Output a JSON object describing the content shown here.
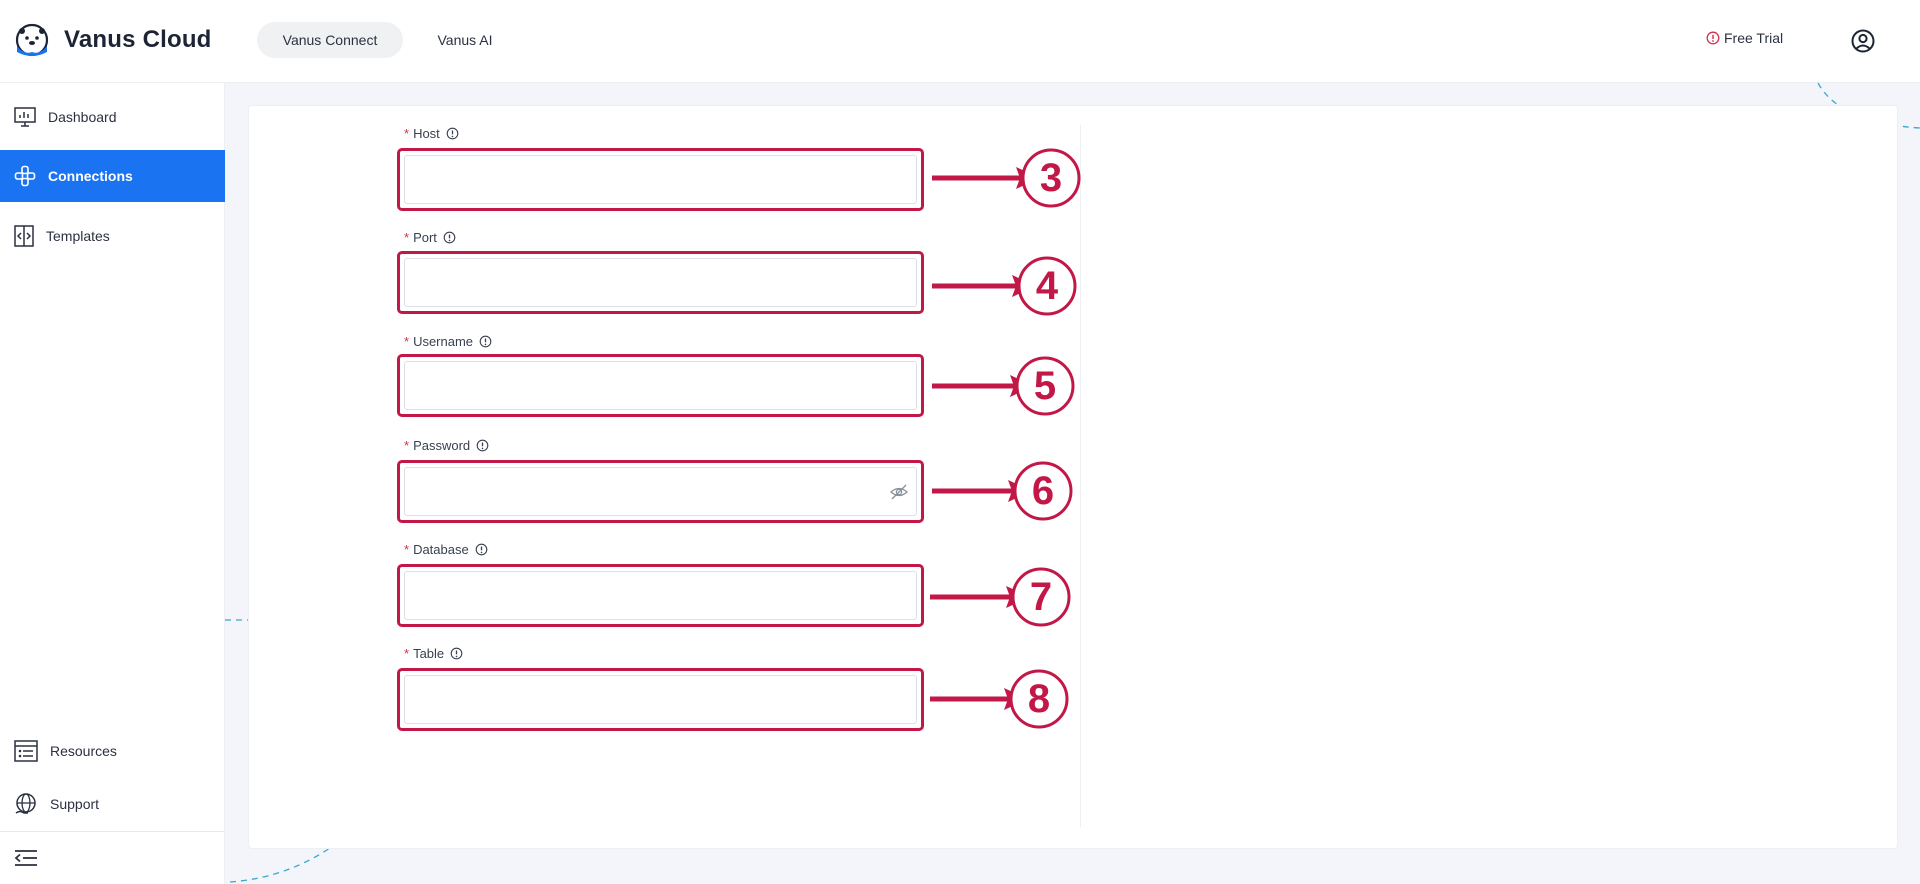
{
  "app": {
    "name": "Vanus Cloud"
  },
  "top_tabs": [
    {
      "label": "Vanus Connect",
      "active": true
    },
    {
      "label": "Vanus AI",
      "active": false
    }
  ],
  "header": {
    "free_trial_label": "Free Trial"
  },
  "sidebar": {
    "items": [
      {
        "label": "Dashboard",
        "icon": "dashboard-icon",
        "active": false
      },
      {
        "label": "Connections",
        "icon": "connections-icon",
        "active": true
      },
      {
        "label": "Templates",
        "icon": "templates-icon",
        "active": false
      }
    ],
    "bottom_items": [
      {
        "label": "Resources",
        "icon": "resources-icon"
      },
      {
        "label": "Support",
        "icon": "support-icon"
      }
    ]
  },
  "form": {
    "fields": [
      {
        "label": "Host",
        "required": true,
        "value": "",
        "callout": "3"
      },
      {
        "label": "Port",
        "required": true,
        "value": "",
        "callout": "4"
      },
      {
        "label": "Username",
        "required": true,
        "value": "",
        "callout": "5"
      },
      {
        "label": "Password",
        "required": true,
        "value": "",
        "callout": "6",
        "masked": true
      },
      {
        "label": "Database",
        "required": true,
        "value": "",
        "callout": "7"
      },
      {
        "label": "Table",
        "required": true,
        "value": "",
        "callout": "8"
      }
    ]
  },
  "colors": {
    "accent": "#1a73f0",
    "annotation": "#c21848",
    "required": "#d3304c"
  }
}
